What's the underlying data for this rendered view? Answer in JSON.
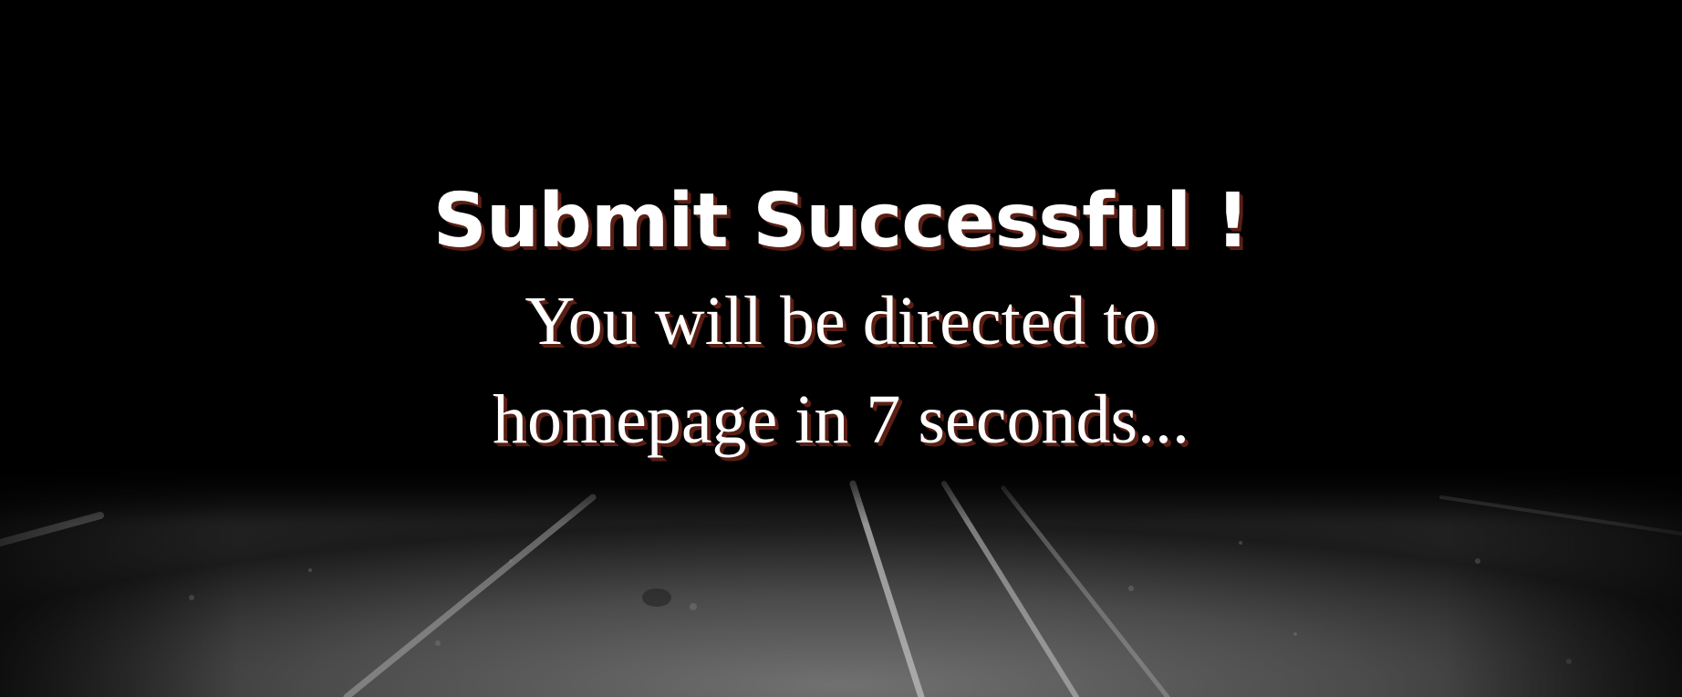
{
  "page": {
    "title": "Submit Successful !",
    "message": "You will be directed to homepage in 7 seconds...",
    "redirect_seconds": 7
  },
  "colors": {
    "background": "#000000",
    "text": "#ffffff",
    "text_shadow": "#5a1f14"
  }
}
